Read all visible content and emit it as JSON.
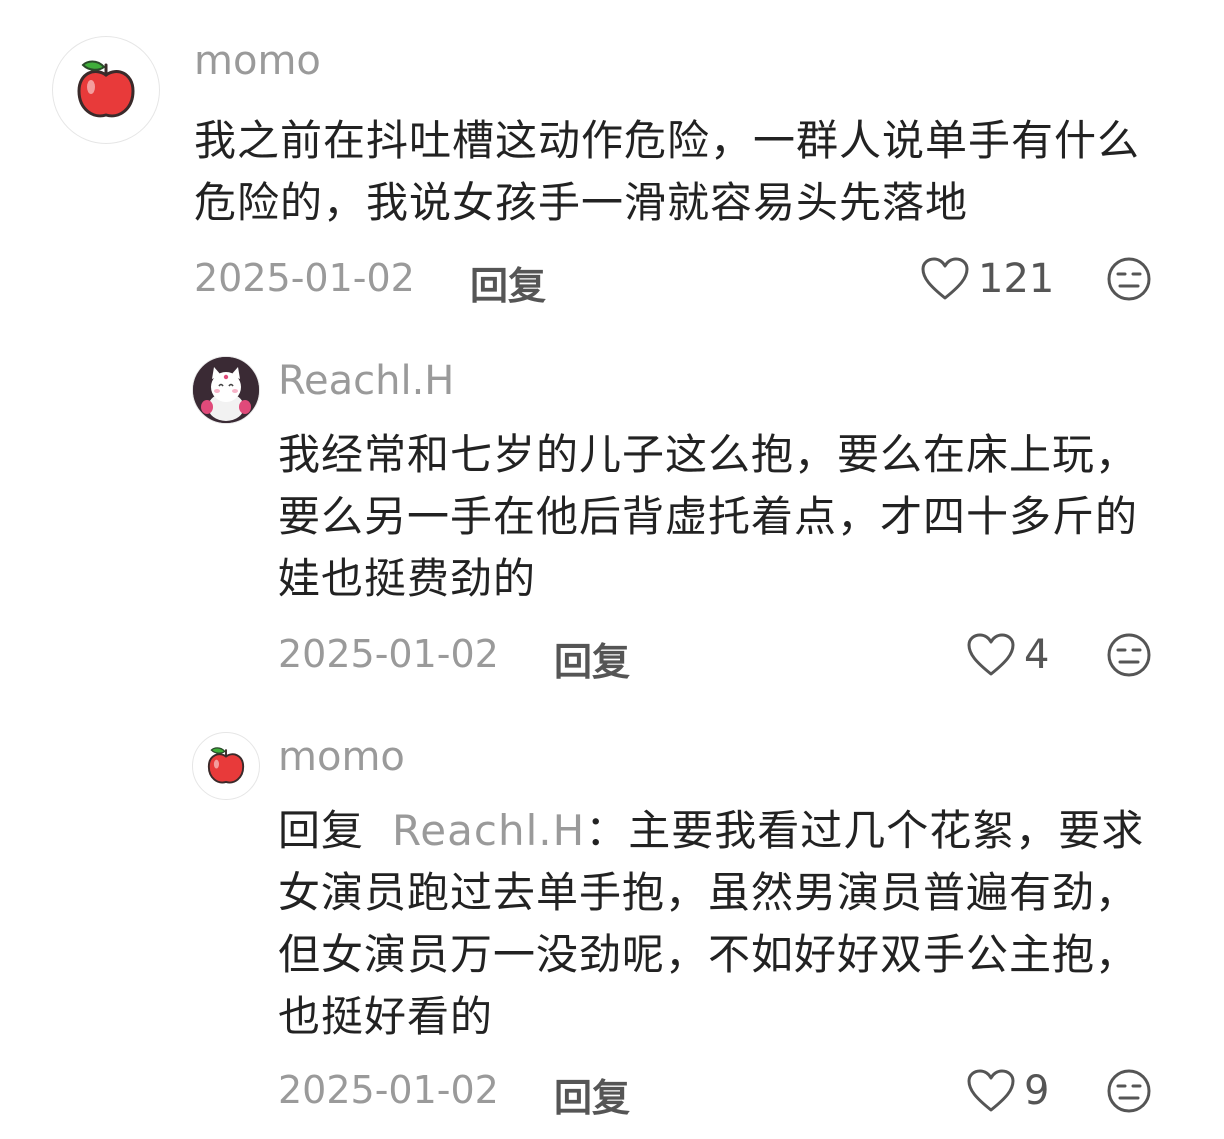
{
  "comments": [
    {
      "username": "momo",
      "avatar_icon": "apple-icon",
      "text": "我之前在抖吐槽这动作危险，一群人说单手有什么危险的，我说女孩手一滑就容易头先落地",
      "date": "2025-01-02",
      "reply_label": "回复",
      "likes": "121"
    },
    {
      "username": "Reachl.H",
      "avatar_icon": "white-cat-icon",
      "text": "我经常和七岁的儿子这么抱，要么在床上玩，要么另一手在他后背虚托着点，才四十多斤的娃也挺费劲的",
      "date": "2025-01-02",
      "reply_label": "回复",
      "likes": "4"
    },
    {
      "username": "momo",
      "avatar_icon": "apple-icon",
      "reply_prefix": "回复",
      "reply_target": "Reachl.H",
      "reply_colon": "：",
      "text": "主要我看过几个花絮，要求女演员跑过去单手抱，虽然男演员普遍有劲，但女演员万一没劲呢，不如好好双手公主抱，也挺好看的",
      "date": "2025-01-02",
      "reply_label": "回复",
      "likes": "9"
    }
  ],
  "colors": {
    "muted_text": "#9a9a9a",
    "body_text": "#222222",
    "icon_stroke": "#555555",
    "apple_red": "#e83a3a",
    "apple_leaf": "#3fae3a"
  }
}
